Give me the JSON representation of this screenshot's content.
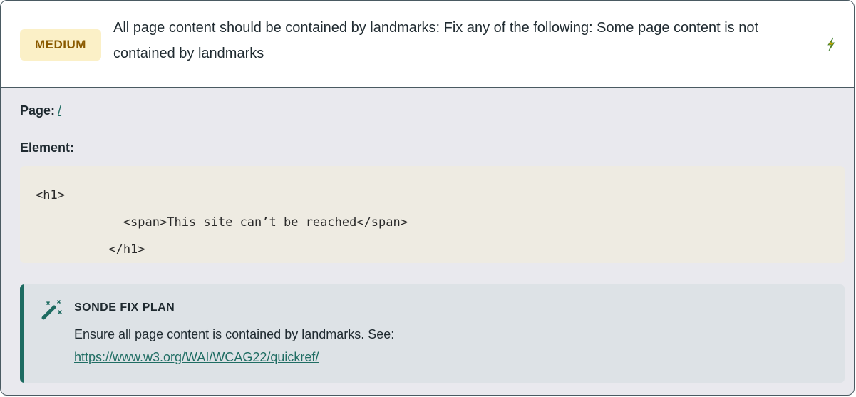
{
  "issue": {
    "severity": "MEDIUM",
    "title": "All page content should be contained by landmarks: Fix any of the following: Some page content is not contained by landmarks",
    "action_icon": "bolt-icon",
    "colors": {
      "severity_bg": "#fbf0c7",
      "severity_text": "#8a5a00",
      "accent": "#1d6b61"
    }
  },
  "details": {
    "page_label": "Page:",
    "page_link": "/",
    "element_label": "Element:",
    "element_code": "<h1>\n            <span>This site can’t be reached</span>\n          </h1>"
  },
  "fix_plan": {
    "icon": "magic-wand-icon",
    "title": "SONDE FIX PLAN",
    "text": "Ensure all page content is contained by landmarks. See:",
    "link": "https://www.w3.org/WAI/WCAG22/quickref/"
  }
}
